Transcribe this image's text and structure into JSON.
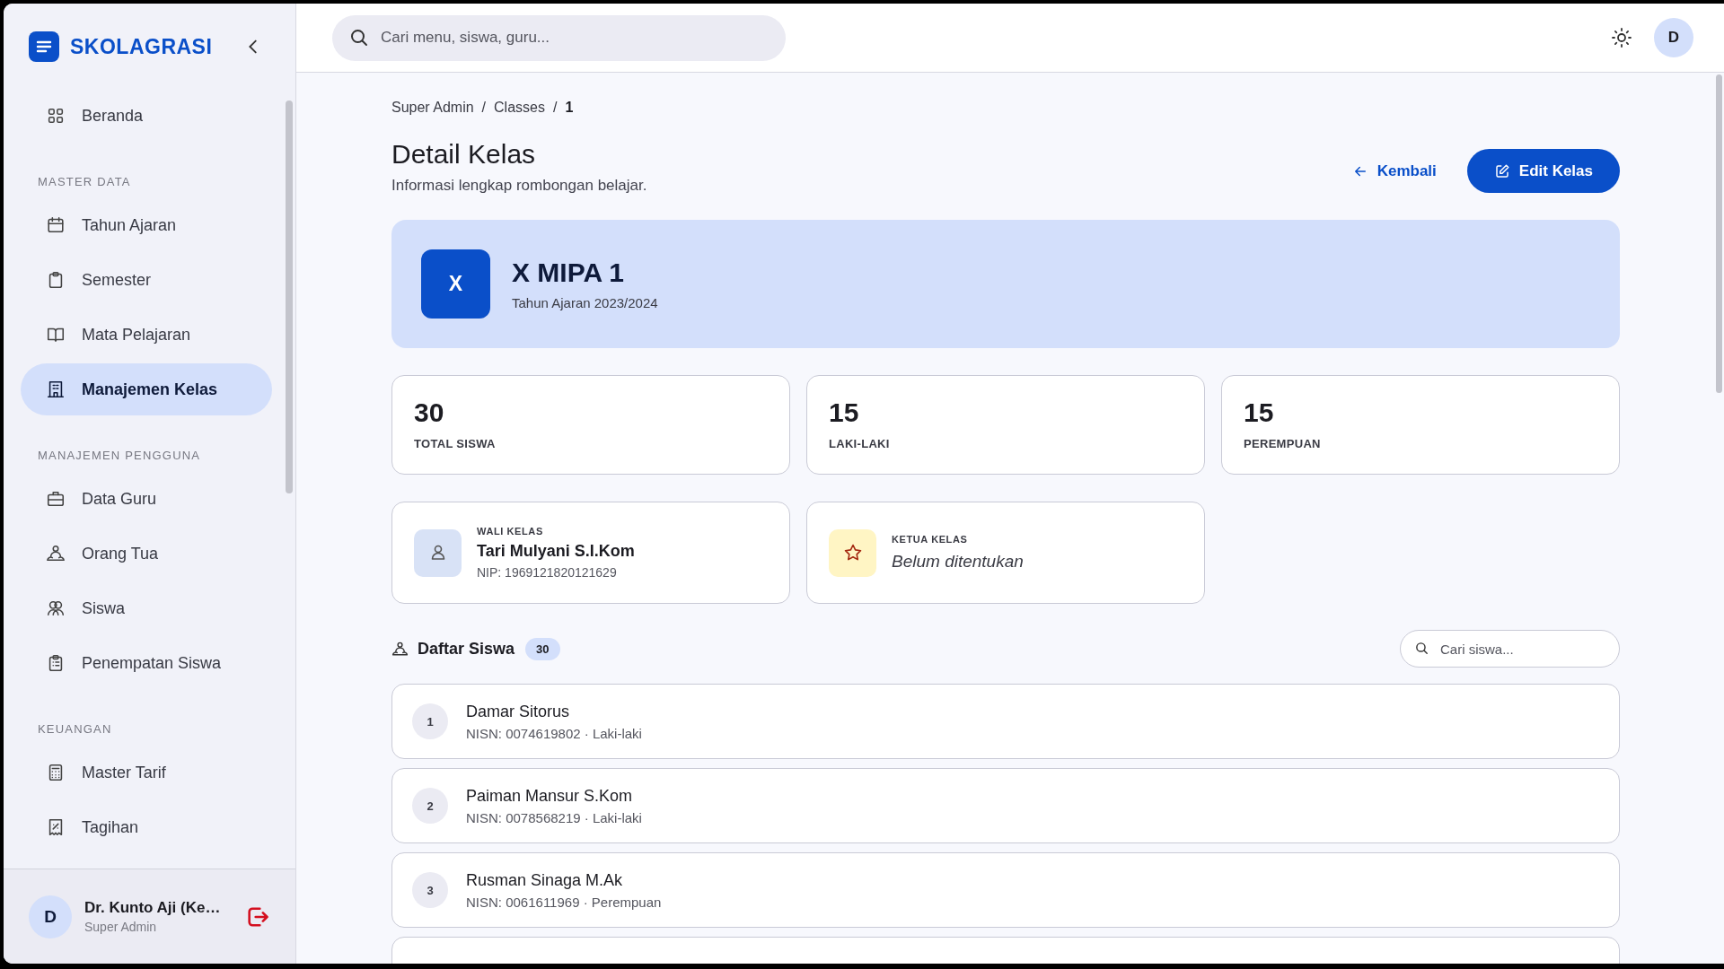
{
  "app": {
    "name": "SKOLAGRASI"
  },
  "sidebar": {
    "sections": [
      {
        "items": [
          {
            "label": "Beranda",
            "selected": false
          }
        ]
      },
      {
        "title": "MASTER DATA",
        "items": [
          {
            "label": "Tahun Ajaran",
            "selected": false
          },
          {
            "label": "Semester",
            "selected": false
          },
          {
            "label": "Mata Pelajaran",
            "selected": false
          },
          {
            "label": "Manajemen Kelas",
            "selected": true
          }
        ]
      },
      {
        "title": "MANAJEMEN PENGGUNA",
        "items": [
          {
            "label": "Data Guru",
            "selected": false
          },
          {
            "label": "Orang Tua",
            "selected": false
          },
          {
            "label": "Siswa",
            "selected": false
          },
          {
            "label": "Penempatan Siswa",
            "selected": false
          }
        ]
      },
      {
        "title": "KEUANGAN",
        "items": [
          {
            "label": "Master Tarif",
            "selected": false
          },
          {
            "label": "Tagihan",
            "selected": false
          }
        ]
      }
    ]
  },
  "user": {
    "initial": "D",
    "name": "Dr. Kunto Aji (Ke…",
    "role": "Super Admin"
  },
  "header": {
    "search_placeholder": "Cari menu, siswa, guru...",
    "avatar": "D"
  },
  "breadcrumb": {
    "separator": "/",
    "items": [
      "Super Admin",
      "Classes",
      "1"
    ]
  },
  "page": {
    "title": "Detail Kelas",
    "subtitle": "Informasi lengkap rombongan belajar."
  },
  "actions": {
    "back": "Kembali",
    "edit": "Edit Kelas"
  },
  "class_banner": {
    "badge": "X",
    "name": "X MIPA 1",
    "year": "Tahun Ajaran 2023/2024"
  },
  "stats": [
    {
      "value": "30",
      "label": "TOTAL SISWA"
    },
    {
      "value": "15",
      "label": "LAKI-LAKI"
    },
    {
      "value": "15",
      "label": "PEREMPUAN"
    }
  ],
  "homeroom": {
    "label": "WALI KELAS",
    "name": "Tari Mulyani S.I.Kom",
    "nip": "NIP: 1969121820121629"
  },
  "class_leader": {
    "label": "KETUA KELAS",
    "value": "Belum ditentukan"
  },
  "students": {
    "title": "Daftar Siswa",
    "count": "30",
    "search_placeholder": "Cari siswa...",
    "rows": [
      {
        "number": "1",
        "name": "Damar Sitorus",
        "detail": "NISN: 0074619802 · Laki-laki"
      },
      {
        "number": "2",
        "name": "Paiman Mansur S.Kom",
        "detail": "NISN: 0078568219 · Laki-laki"
      },
      {
        "number": "3",
        "name": "Rusman Sinaga M.Ak",
        "detail": "NISN: 0061611969 · Perempuan"
      }
    ]
  }
}
